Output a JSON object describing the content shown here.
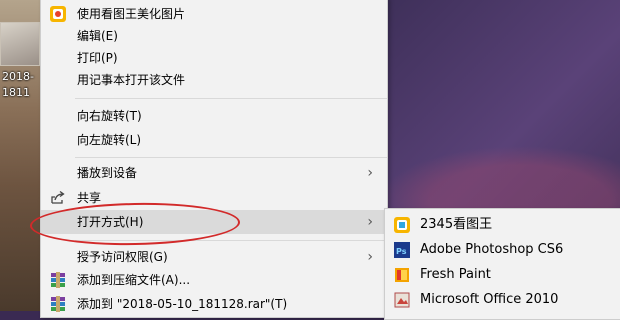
{
  "desktop": {
    "file_label_line1": "2018-",
    "file_label_line2": "1811"
  },
  "menu": {
    "items": [
      {
        "label": "使用看图王美化图片",
        "icon": "kantuwang-beautify-icon"
      },
      {
        "label": "编辑(E)"
      },
      {
        "label": "打印(P)"
      },
      {
        "label": "用记事本打开该文件"
      },
      {
        "label": "向右旋转(T)"
      },
      {
        "label": "向左旋转(L)"
      },
      {
        "label": "播放到设备",
        "has_submenu": true
      },
      {
        "label": "共享",
        "icon": "share-icon"
      },
      {
        "label": "打开方式(H)",
        "has_submenu": true,
        "highlighted": true
      },
      {
        "label": "授予访问权限(G)",
        "has_submenu": true
      },
      {
        "label": "添加到压缩文件(A)...",
        "icon": "winrar-archive-icon"
      },
      {
        "label": "添加到 \"2018-05-10_181128.rar\"(T)",
        "icon": "winrar-archive-icon"
      }
    ]
  },
  "submenu": {
    "items": [
      {
        "label": "2345看图王",
        "icon": "kantuwang-icon"
      },
      {
        "label": "Adobe Photoshop CS6",
        "icon": "photoshop-icon"
      },
      {
        "label": "Fresh Paint",
        "icon": "fresh-paint-icon"
      },
      {
        "label": "Microsoft Office 2010",
        "icon": "office-picture-icon"
      }
    ]
  },
  "colors": {
    "menu_bg": "#f2f2f2",
    "hover_bg": "#dadada",
    "highlight_circle": "#d22a2a",
    "photoshop_blue": "#1b3a8c",
    "fresh_paint_orange": "#f4a300"
  }
}
